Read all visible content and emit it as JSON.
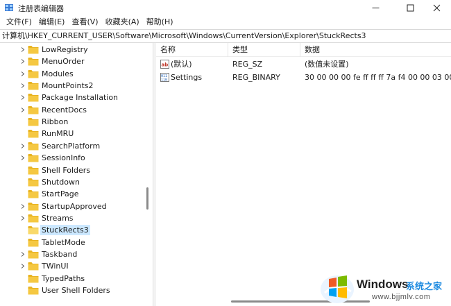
{
  "window": {
    "title": "注册表编辑器",
    "icon": "regedit-icon",
    "controls": [
      "minimize-icon",
      "maximize-icon",
      "close-icon"
    ]
  },
  "menu": [
    "文件(F)",
    "编辑(E)",
    "查看(V)",
    "收藏夹(A)",
    "帮助(H)"
  ],
  "address": "计算机\\HKEY_CURRENT_USER\\Software\\Microsoft\\Windows\\CurrentVersion\\Explorer\\StuckRects3",
  "tree": {
    "items": [
      {
        "label": "LowRegistry",
        "expandable": true
      },
      {
        "label": "MenuOrder",
        "expandable": true
      },
      {
        "label": "Modules",
        "expandable": true
      },
      {
        "label": "MountPoints2",
        "expandable": true
      },
      {
        "label": "Package Installation",
        "expandable": true
      },
      {
        "label": "RecentDocs",
        "expandable": true
      },
      {
        "label": "Ribbon",
        "expandable": false
      },
      {
        "label": "RunMRU",
        "expandable": false
      },
      {
        "label": "SearchPlatform",
        "expandable": true
      },
      {
        "label": "SessionInfo",
        "expandable": true
      },
      {
        "label": "Shell Folders",
        "expandable": false
      },
      {
        "label": "Shutdown",
        "expandable": false
      },
      {
        "label": "StartPage",
        "expandable": false
      },
      {
        "label": "StartupApproved",
        "expandable": true
      },
      {
        "label": "Streams",
        "expandable": true
      },
      {
        "label": "StuckRects3",
        "expandable": false,
        "selected": true
      },
      {
        "label": "TabletMode",
        "expandable": false
      },
      {
        "label": "Taskband",
        "expandable": true
      },
      {
        "label": "TWinUI",
        "expandable": true
      },
      {
        "label": "TypedPaths",
        "expandable": false
      },
      {
        "label": "User Shell Folders",
        "expandable": false
      }
    ]
  },
  "list": {
    "columns": [
      "名称",
      "类型",
      "数据"
    ],
    "rows": [
      {
        "icon": "string-value-icon",
        "name": "(默认)",
        "type": "REG_SZ",
        "data": "(数值未设置)"
      },
      {
        "icon": "binary-value-icon",
        "name": "Settings",
        "type": "REG_BINARY",
        "data": "30 00 00 00 fe ff ff ff 7a f4 00 00 03 00 00"
      }
    ]
  },
  "watermark": {
    "brand": "Windows",
    "site": "系统之家",
    "url": "www.bjjmlv.com",
    "logo": "windows-logo-icon"
  },
  "colors": {
    "selection": "#cce8ff",
    "folder": "#f5c842",
    "accent": "#1e8be0"
  }
}
